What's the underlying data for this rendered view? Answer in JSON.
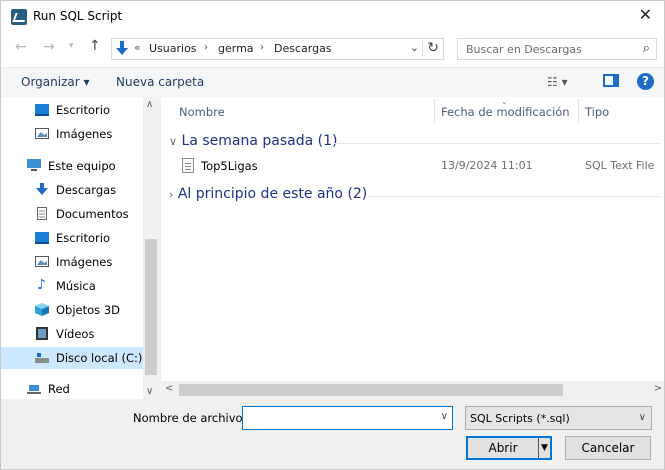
{
  "window": {
    "title": "Run SQL Script"
  },
  "address": {
    "overflow": "«",
    "crumbs": [
      "Usuarios",
      "germa",
      "Descargas"
    ],
    "search_placeholder": "Buscar en Descargas"
  },
  "toolbar": {
    "organize_label": "Organizar ▾",
    "new_folder_label": "Nueva carpeta",
    "help_label": "?"
  },
  "nav": {
    "items": [
      {
        "label": "Escritorio",
        "icon": "desktop-icon"
      },
      {
        "label": "Imágenes",
        "icon": "pictures-icon"
      },
      {
        "label": "Este equipo",
        "icon": "computer-icon"
      },
      {
        "label": "Descargas",
        "icon": "download-icon"
      },
      {
        "label": "Documentos",
        "icon": "documents-icon"
      },
      {
        "label": "Escritorio",
        "icon": "desktop-icon"
      },
      {
        "label": "Imágenes",
        "icon": "pictures-icon"
      },
      {
        "label": "Música",
        "icon": "music-icon"
      },
      {
        "label": "Objetos 3D",
        "icon": "objects3d-icon"
      },
      {
        "label": "Vídeos",
        "icon": "videos-icon"
      },
      {
        "label": "Disco local (C:)",
        "icon": "drive-icon"
      },
      {
        "label": "Red",
        "icon": "network-icon"
      }
    ]
  },
  "files": {
    "columns": {
      "name": "Nombre",
      "date": "Fecha de modificación",
      "type": "Tipo"
    },
    "groups": [
      {
        "label": "La semana pasada (1)",
        "expanded": true
      },
      {
        "label": "Al principio de este año (2)",
        "expanded": false
      }
    ],
    "rows": [
      {
        "name": "Top5Ligas",
        "date": "13/9/2024 11:01",
        "type": "SQL Text File"
      }
    ]
  },
  "bottom": {
    "filename_label": "Nombre de archivo:",
    "filename_value": "",
    "filter_value": "SQL Scripts (*.sql)",
    "open_label": "Abrir",
    "cancel_label": "Cancelar"
  },
  "colors": {
    "accent": "#0078d7",
    "selection": "#cce8ff",
    "group_header": "#1e3287"
  }
}
